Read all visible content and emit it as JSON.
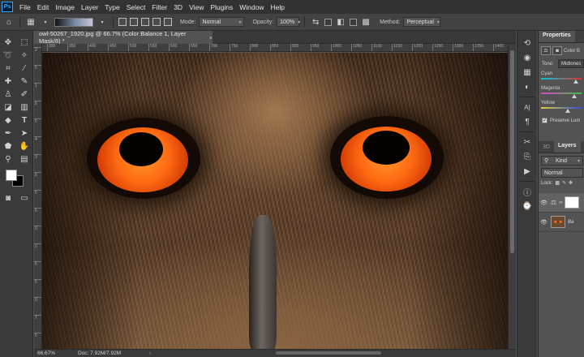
{
  "menubar": {
    "logo": "Ps",
    "items": [
      "File",
      "Edit",
      "Image",
      "Layer",
      "Type",
      "Select",
      "Filter",
      "3D",
      "View",
      "Plugins",
      "Window",
      "Help"
    ]
  },
  "options": {
    "mode_label": "Mode:",
    "mode_value": "Normal",
    "opacity_label": "Opacity:",
    "opacity_value": "100%",
    "method_label": "Method:",
    "method_value": "Perceptual"
  },
  "document": {
    "tab_title": "owl-50267_1920.jpg @ 66.7% (Color Balance 1, Layer Mask/8) *",
    "close": "×"
  },
  "ruler": {
    "h_ticks": [
      "300",
      "350",
      "400",
      "450",
      "500",
      "550",
      "600",
      "650",
      "700",
      "750",
      "800",
      "850",
      "900",
      "950",
      "1000",
      "1050",
      "1100",
      "1150",
      "1200",
      "1250",
      "1300",
      "1350",
      "1400"
    ],
    "v_ticks": [
      "2",
      "5",
      "1",
      "5",
      "0",
      "4",
      "3",
      "5",
      "0",
      "6",
      "0",
      "0",
      "6",
      "5",
      "0",
      "7",
      "0"
    ]
  },
  "status": {
    "zoom": "66.67%",
    "doc": "Doc: 7.92M/7.92M",
    "arrow": "›"
  },
  "panels": {
    "properties_tab": "Properties",
    "color_label": "Color B",
    "tone_label": "Tone:",
    "tone_value": "Midtones",
    "cyan": "Cyan",
    "magenta": "Magenta",
    "yellow": "Yellow",
    "preserve": "Preserve Lum",
    "tab_3d": "3D",
    "tab_layers": "Layers",
    "kind_value": "Kind",
    "blend_value": "Normal",
    "lock_label": "Lock:",
    "layer2_name": "Ba"
  },
  "colors": {
    "accent": "#31a8ff",
    "iris": "#ff6a12",
    "panel_bg": "#535353",
    "menubar_bg": "#323232"
  }
}
